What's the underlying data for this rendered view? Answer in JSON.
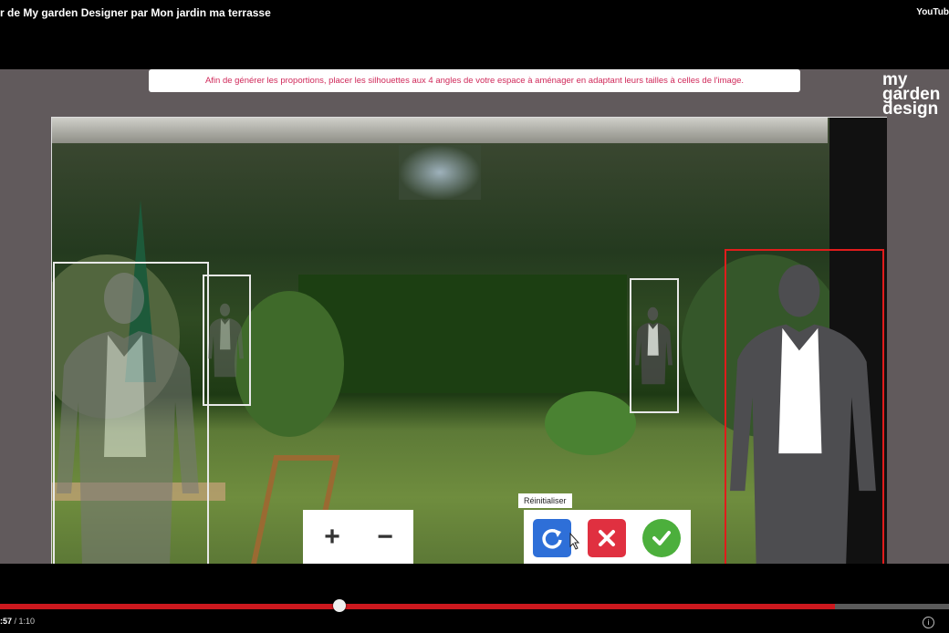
{
  "video": {
    "title": "r de My garden Designer par Mon jardin ma terrasse",
    "platform_label": "YouTub"
  },
  "app": {
    "instruction": "Afin de générer les proportions, placer les silhouettes aux 4 angles de votre espace à aménager en adaptant leurs tailles à celles de l'image.",
    "logo_lines": [
      "my",
      "garden",
      "design"
    ]
  },
  "toolbar": {
    "zoom_in_glyph": "+",
    "zoom_out_glyph": "−",
    "reset_tooltip": "Réinitialiser"
  },
  "player": {
    "current_time": ":57",
    "separator": " / ",
    "duration": "1:10",
    "progress_fraction": 0.358,
    "buffered_fraction": 0.88
  },
  "colors": {
    "selected_frame": "#e01c1c",
    "reset_button": "#2e6fd8",
    "cancel_button": "#e03040",
    "confirm_button": "#4caf3c",
    "progress": "#cc181e"
  },
  "icons": [
    "reset-icon",
    "close-icon",
    "check-icon",
    "cursor-icon",
    "info-icon"
  ]
}
